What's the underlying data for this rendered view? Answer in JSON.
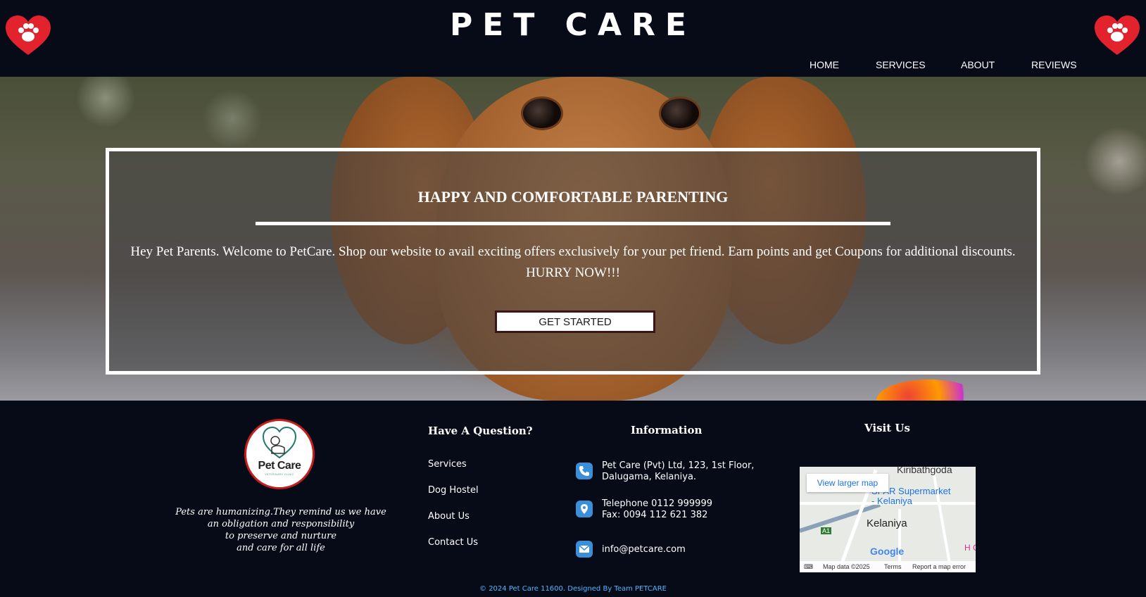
{
  "header": {
    "brand": "PET CARE",
    "logo_icon": "paw-heart-icon",
    "nav": [
      "HOME",
      "SERVICES",
      "ABOUT",
      "REVIEWS"
    ]
  },
  "hero": {
    "title": "HAPPY AND COMFORTABLE PARENTING",
    "text": "Hey Pet Parents. Welcome to PetCare. Shop our website to avail exciting offers exclusively for your pet friend. Earn points and get Coupons for additional discounts. HURRY NOW!!!",
    "cta": "GET STARTED"
  },
  "footer": {
    "logo": {
      "name": "Pet Care",
      "sub": "VETERINARY CLINIC"
    },
    "quote": [
      "Pets are humanizing.They remind us we have",
      "an obligation and responsibility",
      "to preserve and nurture",
      "and care for all life"
    ],
    "question": {
      "title": "Have A Question?",
      "links": [
        "Services",
        "Dog Hostel",
        "About Us",
        "Contact Us"
      ]
    },
    "information": {
      "title": "Information",
      "address": [
        "Pet Care (Pvt) Ltd, 123, 1st Floor,",
        "Dalugama, Kelaniya."
      ],
      "phone": [
        "Telephone 0112 999999",
        "Fax: 0094 112 621 382"
      ],
      "email": "info@petcare.com",
      "icons": [
        "phone-icon",
        "location-icon",
        "mail-icon"
      ]
    },
    "visit": {
      "title": "Visit Us",
      "map_link": "View larger map",
      "labels": {
        "top": "Kiribathgoda",
        "market_line1": "SPAR Supermarket",
        "market_line2": "- Kelaniya",
        "city": "Kelaniya",
        "brand": "Google",
        "road": "A1",
        "poi": "H G"
      },
      "map_footer": [
        "Map data ©2025",
        "Terms",
        "Report a map error"
      ]
    },
    "copyright": "© 2024 Pet Care 11600. Designed By Team PETCARE"
  },
  "colors": {
    "bg": "#070b18",
    "heart": "#e2232d",
    "link_blue": "#4fb7ff",
    "icon_blue": "#3b8fd9"
  }
}
